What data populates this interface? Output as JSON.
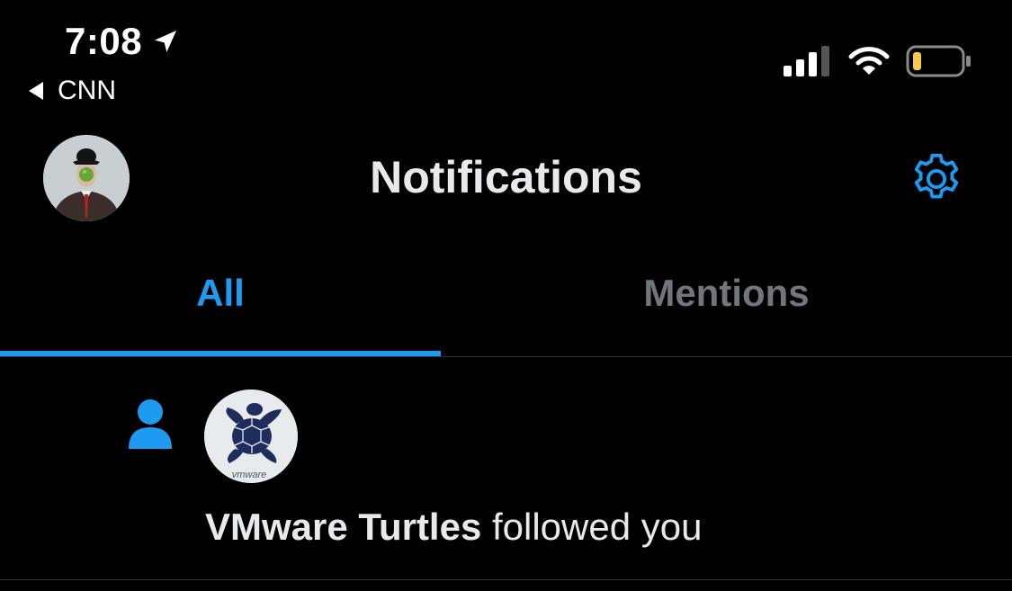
{
  "status_bar": {
    "time": "7:08",
    "back_app": "CNN"
  },
  "header": {
    "title": "Notifications"
  },
  "tabs": [
    {
      "label": "All",
      "active": true
    },
    {
      "label": "Mentions",
      "active": false
    }
  ],
  "notifications": [
    {
      "type": "follow",
      "icon": "person-icon",
      "avatar_text": "vmware",
      "name": "VMware Turtles",
      "action": " followed you"
    }
  ],
  "colors": {
    "accent": "#1d9bf0",
    "inactive_tab": "#71767b",
    "battery": "#f7c948"
  }
}
